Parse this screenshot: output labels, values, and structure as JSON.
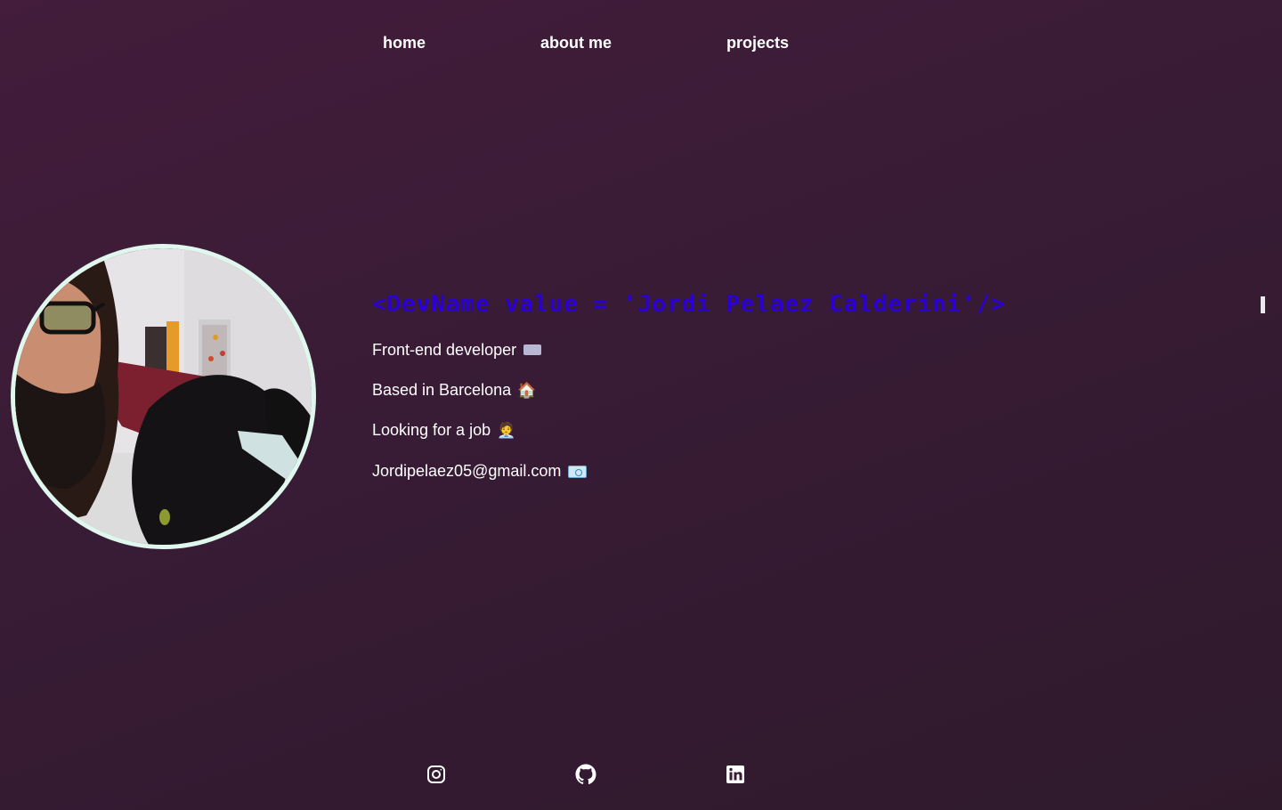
{
  "nav": {
    "items": [
      {
        "label": "home"
      },
      {
        "label": "about me"
      },
      {
        "label": "projects"
      }
    ]
  },
  "hero": {
    "title": "<DevName value = 'Jordi Pelaez Calderini'/>"
  },
  "info": [
    {
      "text": "Front-end developer",
      "emoji": "keyboard-emoji"
    },
    {
      "text": "Based in Barcelona",
      "emoji": "🏠"
    },
    {
      "text": "Looking for a job",
      "emoji": "🧑‍💼"
    },
    {
      "text": "Jordipelaez05@gmail.com",
      "emoji": "email-emoji"
    }
  ],
  "social": [
    {
      "icon": "instagram-icon"
    },
    {
      "icon": "github-icon"
    },
    {
      "icon": "linkedin-icon"
    }
  ],
  "colors": {
    "background": "#3a1b35",
    "title": "#2b00d4",
    "avatar_border": "#dff7ec",
    "text": "#ffffff"
  }
}
